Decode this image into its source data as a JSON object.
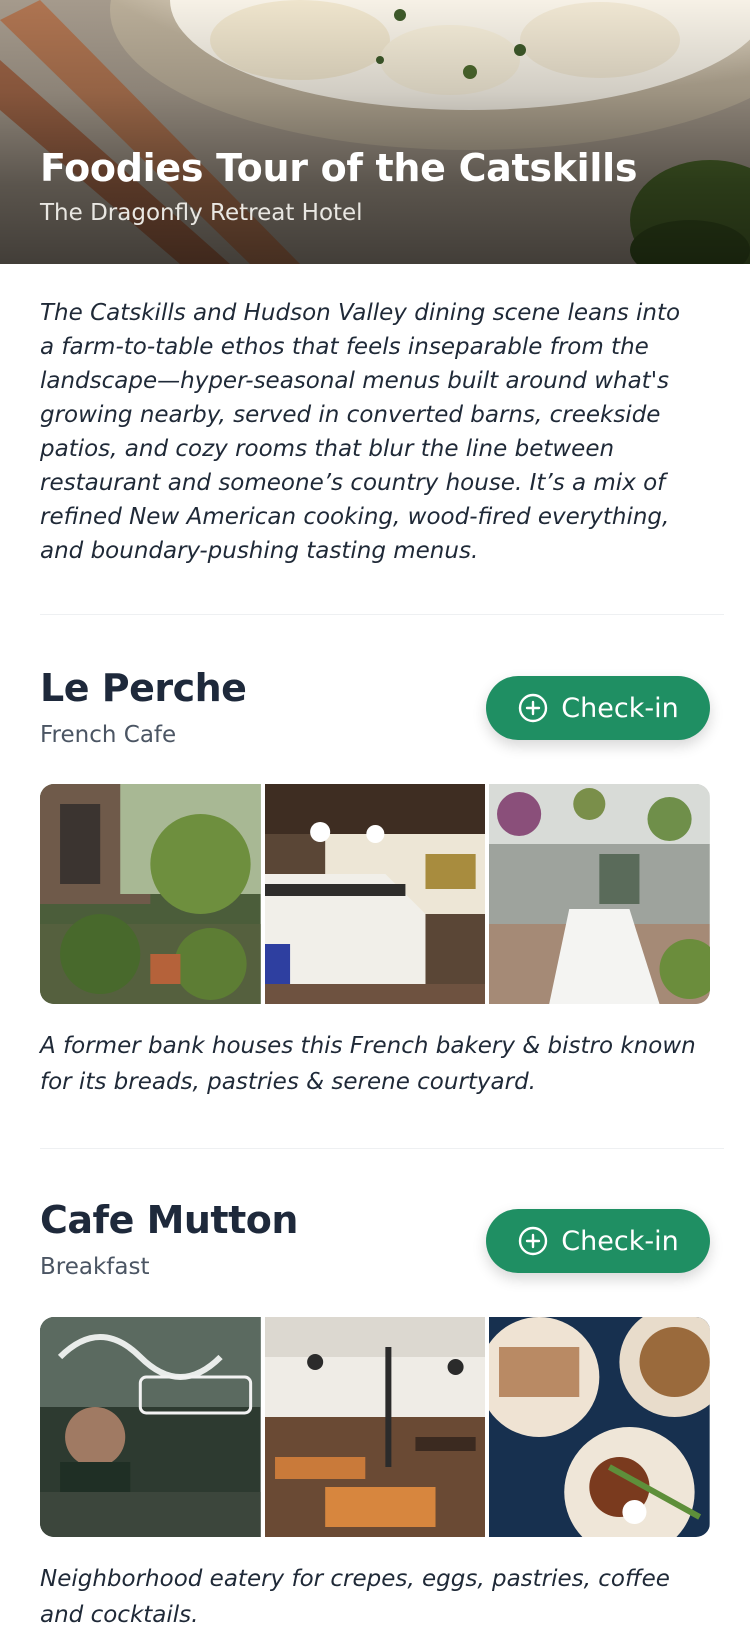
{
  "header": {
    "title": "Foodies Tour of the Catskills",
    "subtitle": "The Dragonfly Retreat Hotel",
    "image_icon": "plated-food-photo"
  },
  "intro": "The Catskills and Hudson Valley dining scene leans into a farm-to-table ethos that feels inseparable from the landscape—hyper-seasonal menus built around what's growing nearby, served in converted barns, creekside patios, and cozy rooms that blur the line between restaurant and someone’s country house. It’s a mix of refined New American cooking, wood-fired everything, and boundary-pushing tasting menus.",
  "restaurants": [
    {
      "name": "Le Perche",
      "category": "French Cafe",
      "checkin_label": "Check-in",
      "checkin_icon": "plus-circle-icon",
      "photos": [
        "courtyard-garden-photo",
        "bakery-counter-photo",
        "greenhouse-dining-photo"
      ],
      "description": "A former bank houses this French bakery & bistro known for its breads, pastries & serene courtyard."
    },
    {
      "name": "Cafe Mutton",
      "category": "Breakfast",
      "checkin_label": "Check-in",
      "checkin_icon": "plus-circle-icon",
      "photos": [
        "storefront-window-photo",
        "dining-room-photo",
        "brunch-plates-photo"
      ],
      "description": "Neighborhood eatery for crepes, eggs, pastries, coffee and cocktails."
    }
  ],
  "colors": {
    "accent": "#1f8f63",
    "heading": "#1e293b",
    "muted": "#4b5563"
  }
}
